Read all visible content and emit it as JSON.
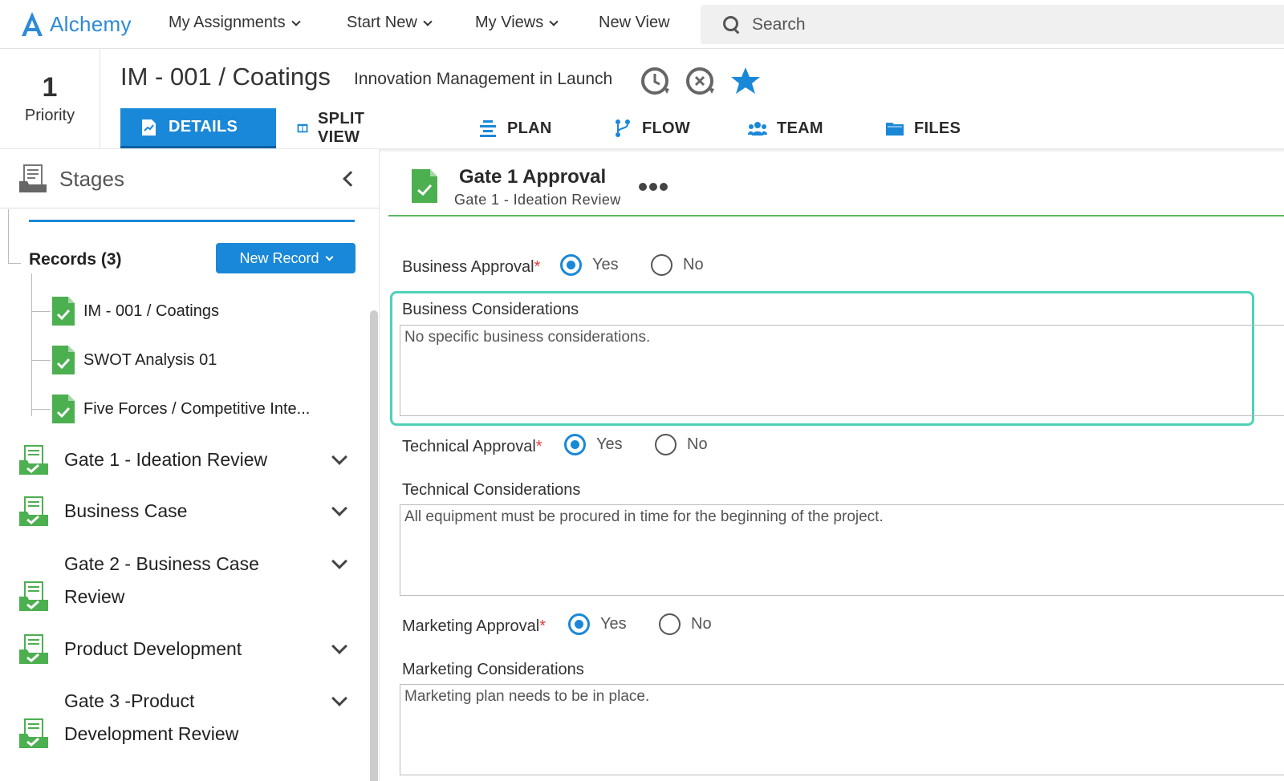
{
  "app": {
    "name": "Alchemy"
  },
  "nav": {
    "items": [
      {
        "label": "My Assignments",
        "dropdown": true
      },
      {
        "label": "Start New",
        "dropdown": true
      },
      {
        "label": "My Views",
        "dropdown": true
      },
      {
        "label": "New View",
        "dropdown": false
      }
    ],
    "search_placeholder": "Search"
  },
  "priority": {
    "value": "1",
    "label": "Priority"
  },
  "record": {
    "title": "IM - 001 / Coatings",
    "subtitle": "Innovation Management in Launch",
    "icons": [
      "history-icon",
      "cancel-history-icon",
      "favorite-star-icon"
    ]
  },
  "tabs": [
    {
      "label": "DETAILS",
      "icon": "details-icon",
      "active": true
    },
    {
      "label": "SPLIT VIEW",
      "icon": "split-view-icon",
      "active": false
    },
    {
      "label": "PLAN",
      "icon": "plan-icon",
      "active": false
    },
    {
      "label": "FLOW",
      "icon": "flow-icon",
      "active": false
    },
    {
      "label": "TEAM",
      "icon": "team-icon",
      "active": false
    },
    {
      "label": "FILES",
      "icon": "folder-icon",
      "active": false
    }
  ],
  "sidebar": {
    "title": "Stages",
    "records_label": "Records (3)",
    "new_record_label": "New Record",
    "records": [
      {
        "label": "IM - 001 / Coatings"
      },
      {
        "label": "SWOT Analysis 01"
      },
      {
        "label": "Five Forces / Competitive Inte..."
      }
    ],
    "stages": [
      {
        "label": "Gate 1 - Ideation Review"
      },
      {
        "label": "Business Case"
      },
      {
        "label": "Gate 2 - Business Case Review"
      },
      {
        "label": "Product Development"
      },
      {
        "label": "Gate 3 -Product Development Review"
      }
    ]
  },
  "panel": {
    "title": "Gate 1 Approval",
    "subtitle": "Gate 1 - Ideation Review",
    "fields": [
      {
        "label": "Business Approval",
        "required": "*",
        "yes": "Yes",
        "no": "No",
        "selected": "Yes"
      },
      {
        "label": "Technical Approval",
        "required": "*",
        "yes": "Yes",
        "no": "No",
        "selected": "Yes"
      },
      {
        "label": "Marketing Approval",
        "required": "*",
        "yes": "Yes",
        "no": "No",
        "selected": "Yes"
      }
    ],
    "considerations": [
      {
        "label": "Business Considerations",
        "value": "No specific business considerations."
      },
      {
        "label": "Technical Considerations",
        "value": "All equipment must be procured in time for the beginning of the project."
      },
      {
        "label": "Marketing Considerations",
        "value": "Marketing plan needs to be in place."
      }
    ]
  },
  "colors": {
    "accent": "#1a88d8",
    "success": "#4caf50",
    "highlight": "#4fd1b8",
    "required": "#e53935"
  }
}
